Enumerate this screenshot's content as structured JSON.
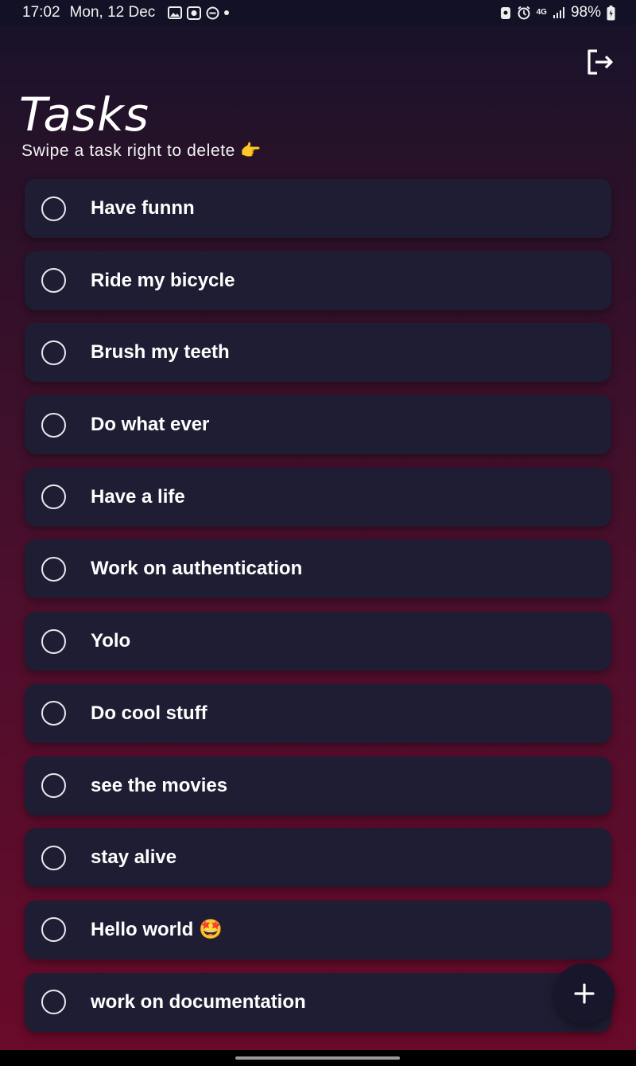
{
  "status_bar": {
    "time": "17:02",
    "date": "Mon, 12 Dec",
    "network": "4G",
    "battery": "98%"
  },
  "header": {
    "title": "Tasks",
    "subtitle": "Swipe a task right to delete 👉",
    "logout_icon": "logout-icon"
  },
  "tasks": [
    {
      "label": "Have funnn",
      "done": false
    },
    {
      "label": "Ride my bicycle",
      "done": false
    },
    {
      "label": "Brush my teeth",
      "done": false
    },
    {
      "label": "Do what ever",
      "done": false
    },
    {
      "label": "Have a life",
      "done": false
    },
    {
      "label": "Work on authentication",
      "done": false
    },
    {
      "label": "Yolo",
      "done": false
    },
    {
      "label": "Do cool stuff",
      "done": false
    },
    {
      "label": "see the movies",
      "done": false
    },
    {
      "label": "stay alive",
      "done": false
    },
    {
      "label": "Hello world 🤩",
      "done": false
    },
    {
      "label": "work on documentation",
      "done": false
    }
  ],
  "fab": {
    "icon": "plus-icon"
  },
  "colors": {
    "card": "#1e1d33",
    "status_bar": "#131126",
    "gradient_top": "#16132a",
    "gradient_bottom": "#6a0a2a"
  }
}
